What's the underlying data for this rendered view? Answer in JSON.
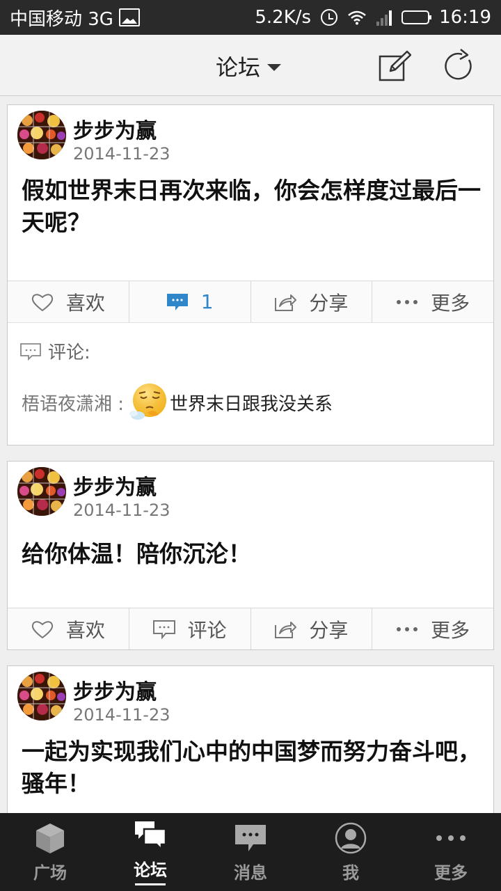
{
  "status_bar": {
    "carrier": "中国移动 3G",
    "speed": "5.2K/s",
    "time": "16:19"
  },
  "header": {
    "title": "论坛"
  },
  "posts": [
    {
      "author": "步步为赢",
      "date": "2014-11-23",
      "content": "假如世界末日再次来临，你会怎样度过最后一天呢？",
      "actions": {
        "like": "喜欢",
        "comment": "1",
        "share": "分享",
        "more": "更多"
      },
      "comments_label": "评论:",
      "comments": [
        {
          "user": "梧语夜潇湘 :",
          "text": "世界末日跟我没关系"
        }
      ]
    },
    {
      "author": "步步为赢",
      "date": "2014-11-23",
      "content": "给你体温！陪你沉沦！",
      "actions": {
        "like": "喜欢",
        "comment": "评论",
        "share": "分享",
        "more": "更多"
      }
    },
    {
      "author": "步步为赢",
      "date": "2014-11-23",
      "content": "一起为实现我们心中的中国梦而努力奋斗吧，骚年！"
    }
  ],
  "tabbar": {
    "items": [
      {
        "label": "广场",
        "icon": "cube-icon"
      },
      {
        "label": "论坛",
        "icon": "forum-icon"
      },
      {
        "label": "消息",
        "icon": "message-icon"
      },
      {
        "label": "我",
        "icon": "profile-icon"
      },
      {
        "label": "更多",
        "icon": "more-dots-icon"
      }
    ],
    "active_index": 1
  },
  "colors": {
    "accent": "#2f86c9",
    "status_bar_bg": "#2a2a2a",
    "tabbar_bg": "#1d1d1d"
  }
}
